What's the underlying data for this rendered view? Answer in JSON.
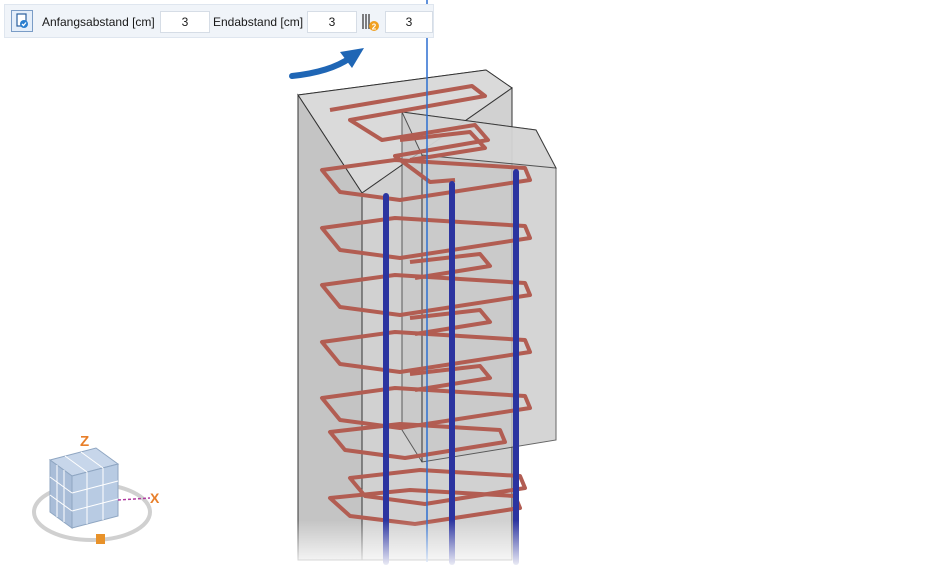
{
  "toolbar": {
    "start_label": "Anfangsabstand [cm]",
    "start_value": "3",
    "end_label": "Endabstand [cm]",
    "end_value": "3",
    "count_value": "3"
  },
  "viewcube": {
    "z_label": "Z",
    "x_label": "X"
  },
  "colors": {
    "stirrup": "#b25d52",
    "longitudinal_bar": "#2b34a0",
    "concrete": "#d9d9d9",
    "guide_line": "#2d6fd0",
    "arrow": "#1f66b5"
  }
}
